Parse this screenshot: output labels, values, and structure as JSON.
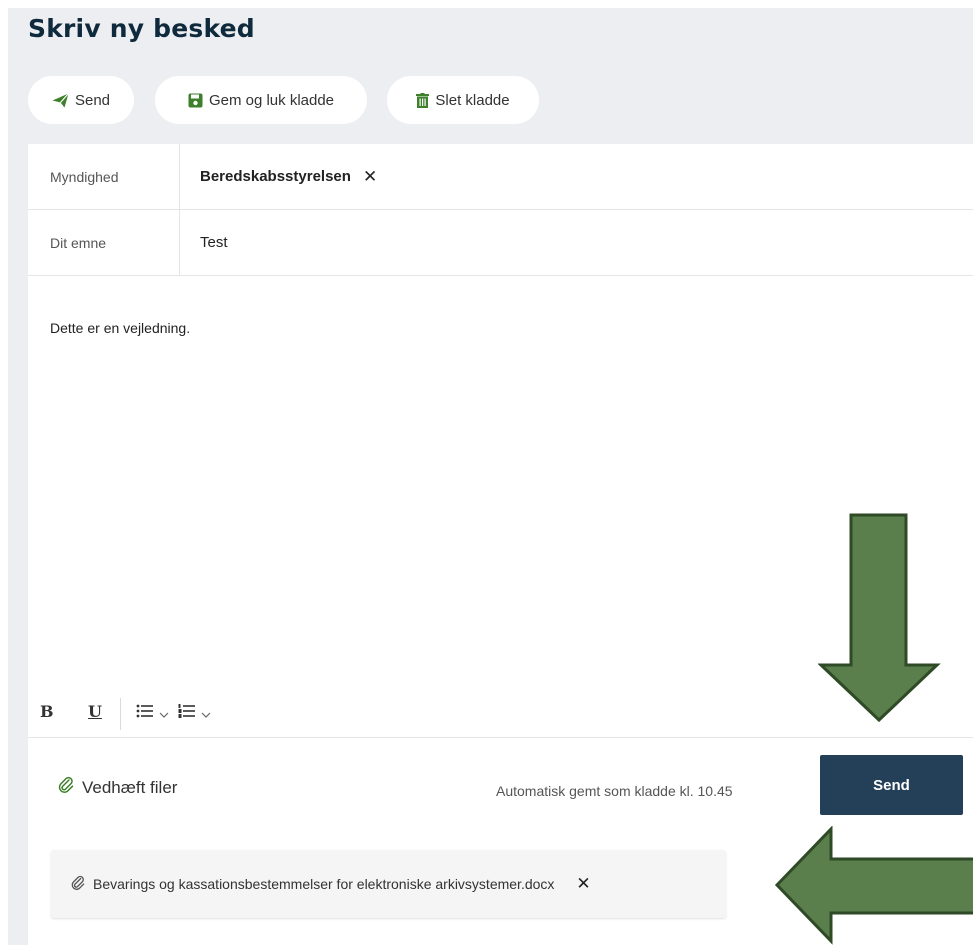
{
  "header": {
    "title": "Skriv ny besked"
  },
  "toolbar": {
    "send_label": "Send",
    "save_label": "Gem og luk kladde",
    "delete_label": "Slet kladde"
  },
  "form": {
    "authority_label": "Myndighed",
    "authority_value": "Beredskabsstyrelsen",
    "subject_label": "Dit emne",
    "subject_value": "Test",
    "body_text": "Dette er en vejledning."
  },
  "format_toolbar": {
    "bold": "B",
    "underline": "U"
  },
  "footer": {
    "attach_label": "Vedhæft filer",
    "autosave_text": "Automatisk gemt som kladde kl. 10.45",
    "send_label": "Send"
  },
  "attachments": [
    {
      "filename": "Bevarings og kassationsbestemmelser for elektroniske arkivsystemer.docx"
    }
  ],
  "colors": {
    "accent_green": "#3e7f2b",
    "primary_button": "#234058",
    "title": "#0f2a3c",
    "arrow_fill": "#5a7e4c",
    "arrow_stroke": "#2f4a26"
  }
}
